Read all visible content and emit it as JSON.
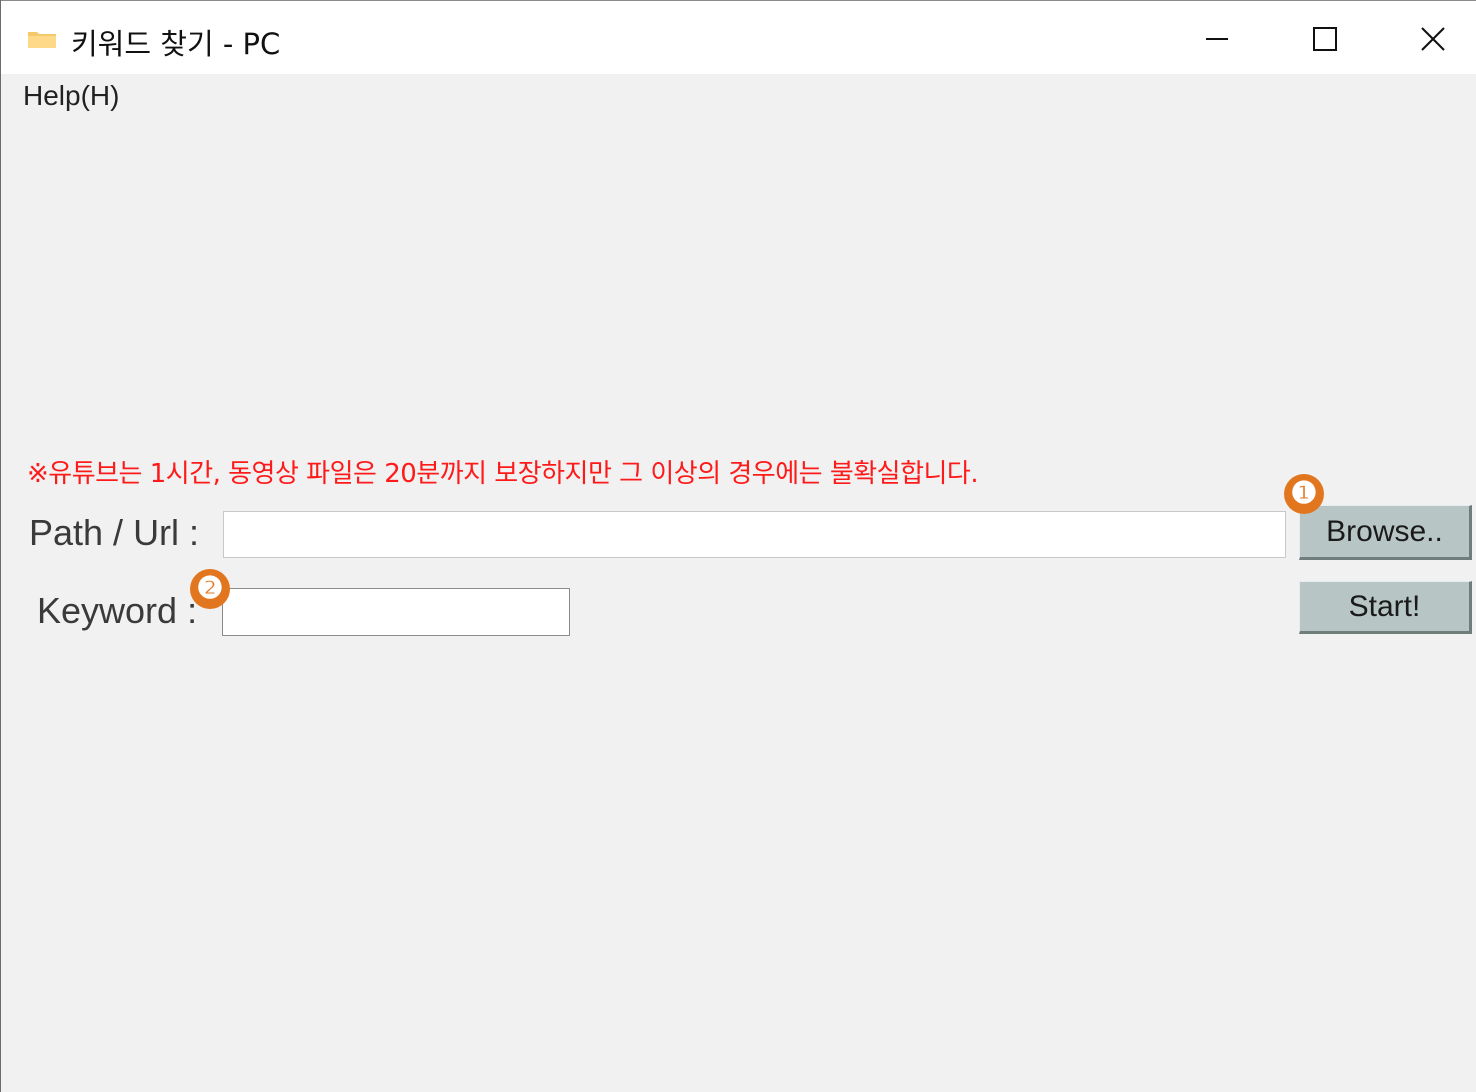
{
  "window": {
    "title": "키워드 찾기 - PC",
    "icon": "folder-icon",
    "controls": [
      "minimize-icon",
      "maximize-icon",
      "close-icon"
    ]
  },
  "menu": {
    "items": [
      {
        "label": "Help(H)"
      }
    ]
  },
  "form": {
    "warning": "※유튜브는 1시간, 동영상 파일은 20분까지 보장하지만 그 이상의 경우에는 불확실합니다.",
    "path_label": "Path / Url :",
    "path_value": "",
    "keyword_label": "Keyword :",
    "keyword_value": "",
    "browse_label": "Browse..",
    "start_label": "Start!"
  },
  "annotations": {
    "badge_1": "❶",
    "badge_2": "❷",
    "color": "#e2761f"
  },
  "colors": {
    "warning": "#ff1a1a",
    "button_bg": "#b7c6c4",
    "window_bg": "#f1f1f1"
  }
}
